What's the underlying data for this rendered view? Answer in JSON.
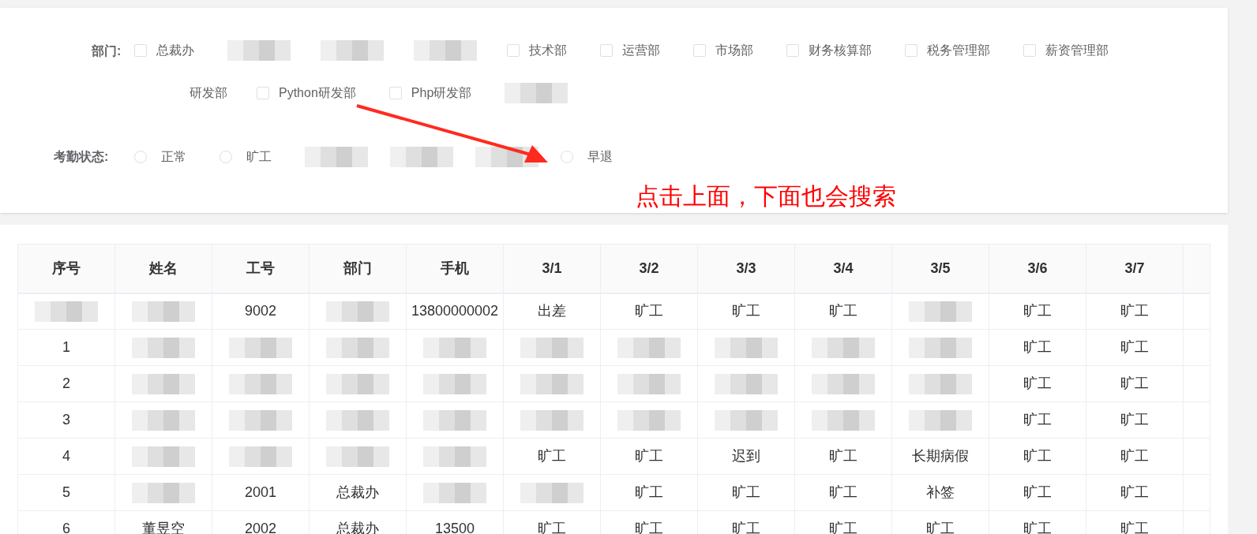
{
  "filters": {
    "department": {
      "label": "部门:",
      "rows": [
        [
          {
            "kind": "checkbox",
            "label": "总裁办",
            "checked": false
          },
          {
            "kind": "redacted"
          },
          {
            "kind": "redacted"
          },
          {
            "kind": "redacted"
          },
          {
            "kind": "checkbox",
            "label": "技术部",
            "checked": false
          },
          {
            "kind": "checkbox",
            "label": "运营部",
            "checked": false
          },
          {
            "kind": "checkbox",
            "label": "市场部",
            "checked": false
          },
          {
            "kind": "checkbox",
            "label": "财务核算部",
            "checked": false
          },
          {
            "kind": "checkbox",
            "label": "税务管理部",
            "checked": false
          },
          {
            "kind": "checkbox",
            "label": "薪资管理部",
            "checked": false
          }
        ],
        [
          {
            "kind": "partial",
            "label": "研发部"
          },
          {
            "kind": "checkbox",
            "label": "Python研发部",
            "checked": false
          },
          {
            "kind": "checkbox",
            "label": "Php研发部",
            "checked": false
          },
          {
            "kind": "redacted"
          }
        ]
      ]
    },
    "attendance": {
      "label": "考勤状态:",
      "options": [
        {
          "kind": "radio",
          "label": "正常",
          "selected": false
        },
        {
          "kind": "radio",
          "label": "旷工",
          "selected": false
        },
        {
          "kind": "redacted"
        },
        {
          "kind": "redacted"
        },
        {
          "kind": "redacted"
        },
        {
          "kind": "radio",
          "label": "早退",
          "selected": false
        }
      ]
    },
    "annotation": {
      "text": "点击上面，下面也会搜索"
    }
  },
  "table": {
    "columns": [
      "序号",
      "姓名",
      "工号",
      "部门",
      "手机",
      "3/1",
      "3/2",
      "3/3",
      "3/4",
      "3/5",
      "3/6",
      "3/7",
      ""
    ],
    "rows": [
      [
        null,
        null,
        "9002",
        null,
        "13800000002",
        "出差",
        "旷工",
        "旷工",
        "旷工",
        null,
        "旷工",
        "旷工",
        ""
      ],
      [
        "1",
        null,
        null,
        null,
        null,
        null,
        null,
        null,
        null,
        null,
        "旷工",
        "旷工",
        ""
      ],
      [
        "2",
        null,
        null,
        null,
        null,
        null,
        null,
        null,
        null,
        null,
        "旷工",
        "旷工",
        ""
      ],
      [
        "3",
        null,
        null,
        null,
        null,
        null,
        null,
        null,
        null,
        null,
        "旷工",
        "旷工",
        ""
      ],
      [
        "4",
        null,
        null,
        null,
        null,
        "旷工",
        "旷工",
        "迟到",
        "旷工",
        "长期病假",
        "旷工",
        "旷工",
        ""
      ],
      [
        "5",
        null,
        "2001",
        "总裁办",
        null,
        null,
        "旷工",
        "旷工",
        "旷工",
        "补签",
        "旷工",
        "旷工",
        ""
      ],
      [
        "6",
        "董昱空",
        "2002",
        "总裁办",
        "13500",
        "旷工",
        "旷工",
        "旷工",
        "旷工",
        "旷工",
        "旷工",
        "旷工",
        ""
      ]
    ]
  }
}
